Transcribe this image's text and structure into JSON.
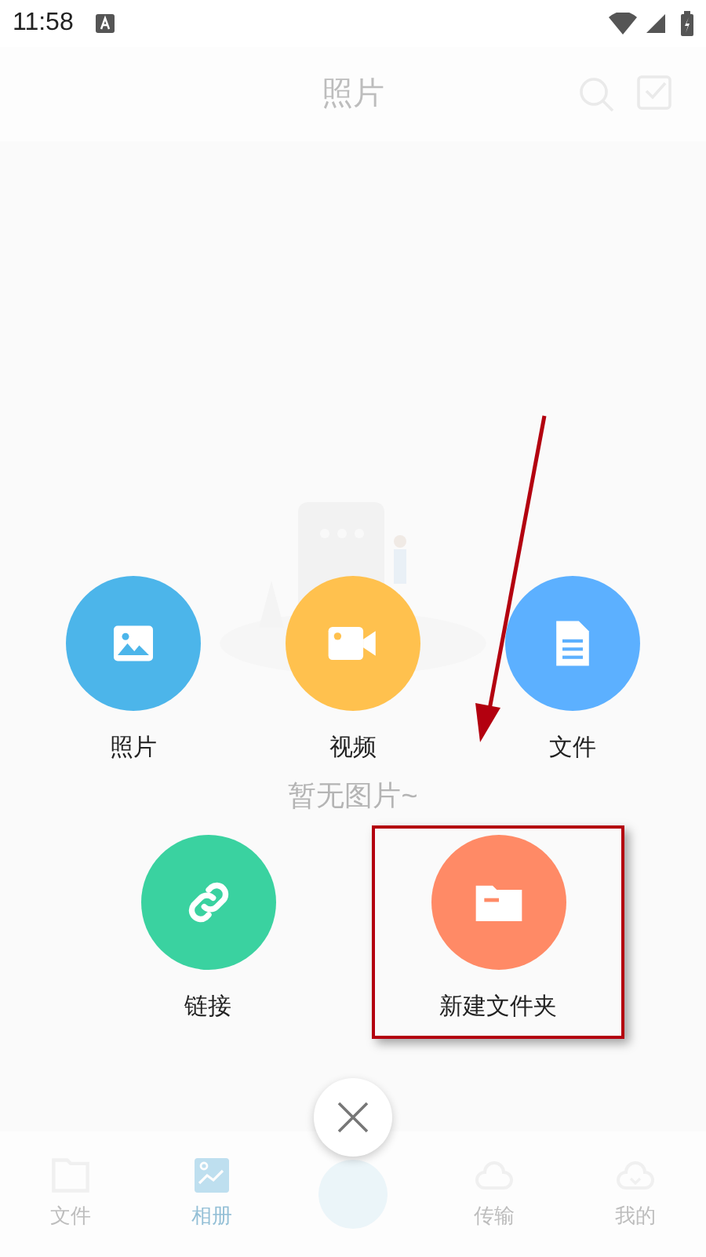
{
  "status_bar": {
    "time": "11:58"
  },
  "header": {
    "title": "照片"
  },
  "empty_state": {
    "message": "暂无图片~"
  },
  "bottom_nav": [
    {
      "label": "文件",
      "selected": false
    },
    {
      "label": "相册",
      "selected": true
    },
    {
      "label": "传输",
      "selected": false
    },
    {
      "label": "我的",
      "selected": false
    }
  ],
  "actions": [
    {
      "kind": "photo",
      "label": "照片",
      "color": "#4cb5ea",
      "highlighted": false
    },
    {
      "kind": "video",
      "label": "视频",
      "color": "#ffc14e",
      "highlighted": false
    },
    {
      "kind": "file",
      "label": "文件",
      "color": "#5cb0ff",
      "highlighted": false
    },
    {
      "kind": "link",
      "label": "链接",
      "color": "#3ad2a0",
      "highlighted": false
    },
    {
      "kind": "folder",
      "label": "新建文件夹",
      "color": "#ff8a66",
      "highlighted": true
    }
  ]
}
